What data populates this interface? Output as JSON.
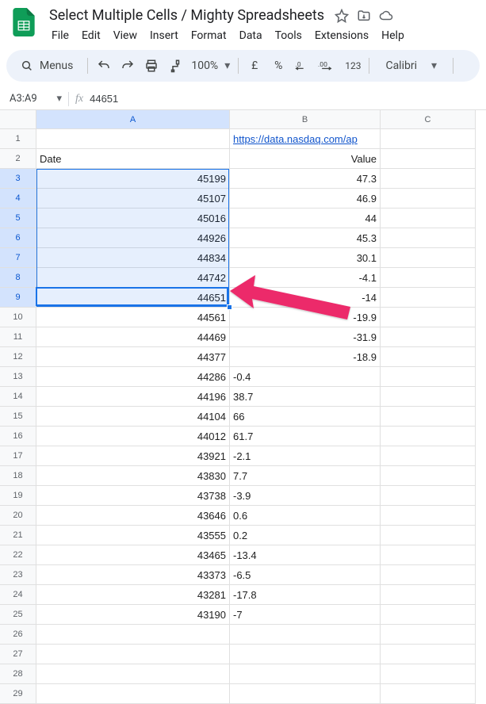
{
  "doc": {
    "title": "Select Multiple Cells / Mighty Spreadsheets"
  },
  "menubar": [
    "File",
    "Edit",
    "View",
    "Insert",
    "Format",
    "Data",
    "Tools",
    "Extensions",
    "Help"
  ],
  "toolbar": {
    "menus_label": "Menus",
    "zoom": "100%",
    "currency": "£",
    "percent": "%",
    "dec_dec": ".0",
    "inc_dec": ".00",
    "num123": "123",
    "font": "Calibri"
  },
  "namebox": {
    "range": "A3:A9",
    "formula_value": "44651"
  },
  "columns": [
    "A",
    "B",
    "C"
  ],
  "col_widths": {
    "A": 244,
    "B": 190,
    "C": 120
  },
  "selection": {
    "col": "A",
    "row_start": 3,
    "row_end": 9,
    "active_row": 9
  },
  "rows": [
    {
      "n": 1,
      "A": "",
      "B": "https://data.nasdaq.com/ap",
      "B_link": true,
      "B_align": "left"
    },
    {
      "n": 2,
      "A": "Date",
      "A_align": "left",
      "B": "Value",
      "B_align": "right"
    },
    {
      "n": 3,
      "A": "45199",
      "B": "47.3",
      "B_align": "right"
    },
    {
      "n": 4,
      "A": "45107",
      "B": "46.9",
      "B_align": "right"
    },
    {
      "n": 5,
      "A": "45016",
      "B": "44",
      "B_align": "right"
    },
    {
      "n": 6,
      "A": "44926",
      "B": "45.3",
      "B_align": "right"
    },
    {
      "n": 7,
      "A": "44834",
      "B": "30.1",
      "B_align": "right"
    },
    {
      "n": 8,
      "A": "44742",
      "B": "-4.1",
      "B_align": "right"
    },
    {
      "n": 9,
      "A": "44651",
      "B": "-14",
      "B_align": "right"
    },
    {
      "n": 10,
      "A": "44561",
      "B": "-19.9",
      "B_align": "right"
    },
    {
      "n": 11,
      "A": "44469",
      "B": "-31.9",
      "B_align": "right"
    },
    {
      "n": 12,
      "A": "44377",
      "B": "-18.9",
      "B_align": "right"
    },
    {
      "n": 13,
      "A": "44286",
      "B": "-0.4",
      "B_align": "left"
    },
    {
      "n": 14,
      "A": "44196",
      "B": "38.7",
      "B_align": "left"
    },
    {
      "n": 15,
      "A": "44104",
      "B": "66",
      "B_align": "left"
    },
    {
      "n": 16,
      "A": "44012",
      "B": "61.7",
      "B_align": "left"
    },
    {
      "n": 17,
      "A": "43921",
      "B": "-2.1",
      "B_align": "left"
    },
    {
      "n": 18,
      "A": "43830",
      "B": "7.7",
      "B_align": "left"
    },
    {
      "n": 19,
      "A": "43738",
      "B": "-3.9",
      "B_align": "left"
    },
    {
      "n": 20,
      "A": "43646",
      "B": "0.6",
      "B_align": "left"
    },
    {
      "n": 21,
      "A": "43555",
      "B": "0.2",
      "B_align": "left"
    },
    {
      "n": 22,
      "A": "43465",
      "B": "-13.4",
      "B_align": "left"
    },
    {
      "n": 23,
      "A": "43373",
      "B": "-6.5",
      "B_align": "left"
    },
    {
      "n": 24,
      "A": "43281",
      "B": "-17.8",
      "B_align": "left"
    },
    {
      "n": 25,
      "A": "43190",
      "B": "-7",
      "B_align": "left"
    },
    {
      "n": 26,
      "A": "",
      "B": ""
    },
    {
      "n": 27,
      "A": "",
      "B": ""
    },
    {
      "n": 28,
      "A": "",
      "B": ""
    },
    {
      "n": 29,
      "A": "",
      "B": ""
    }
  ],
  "chart_data": {
    "type": "table",
    "title": "Select Multiple Cells / Mighty Spreadsheets",
    "columns": [
      "Date",
      "Value"
    ],
    "rows": [
      [
        45199,
        47.3
      ],
      [
        45107,
        46.9
      ],
      [
        45016,
        44
      ],
      [
        44926,
        45.3
      ],
      [
        44834,
        30.1
      ],
      [
        44742,
        -4.1
      ],
      [
        44651,
        -14
      ],
      [
        44561,
        -19.9
      ],
      [
        44469,
        -31.9
      ],
      [
        44377,
        -18.9
      ],
      [
        44286,
        -0.4
      ],
      [
        44196,
        38.7
      ],
      [
        44104,
        66
      ],
      [
        44012,
        61.7
      ],
      [
        43921,
        -2.1
      ],
      [
        43830,
        7.7
      ],
      [
        43738,
        -3.9
      ],
      [
        43646,
        0.6
      ],
      [
        43555,
        0.2
      ],
      [
        43465,
        -13.4
      ],
      [
        43373,
        -6.5
      ],
      [
        43281,
        -17.8
      ],
      [
        43190,
        -7
      ]
    ]
  }
}
